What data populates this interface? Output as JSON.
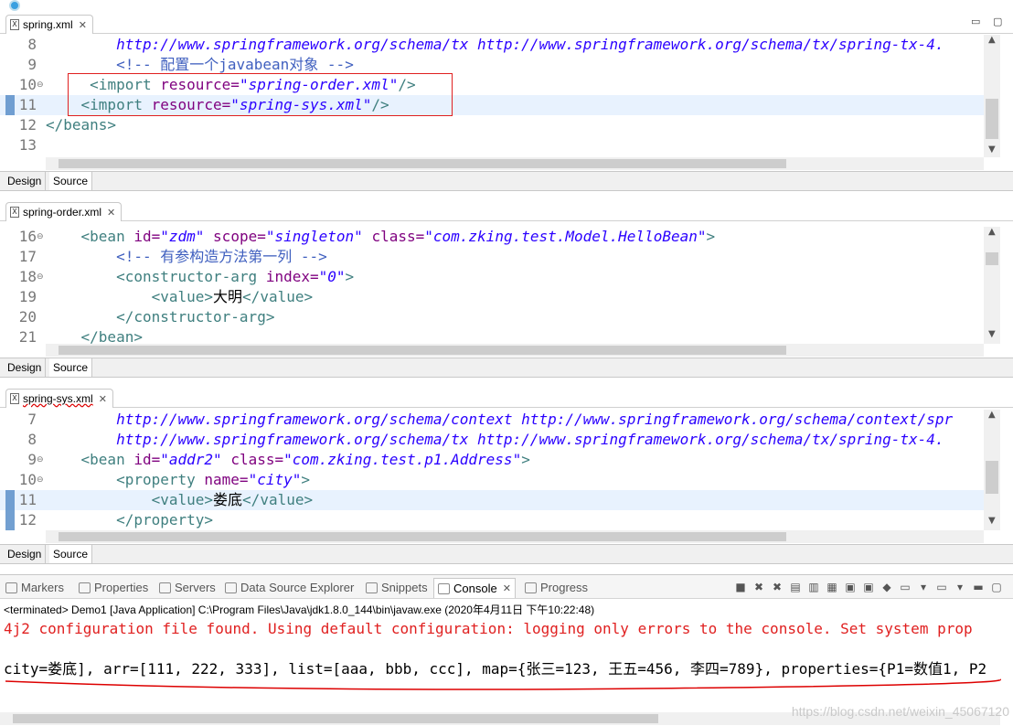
{
  "editors": [
    {
      "tab": "spring.xml",
      "lines": [
        {
          "num": "8",
          "code": [
            [
              "        ",
              "tx"
            ],
            [
              "http://www.springframework.org/schema/tx http://www.springframework.org/schema/tx/spring-tx-4.",
              "va"
            ]
          ]
        },
        {
          "num": "9",
          "code": [
            [
              "        ",
              "tx"
            ],
            [
              "<!-- 配置一个javabean对象 -->",
              "cm"
            ]
          ]
        },
        {
          "num": "10",
          "code": [
            [
              "     ",
              "tx"
            ],
            [
              "<import ",
              "tg"
            ],
            [
              "resource=",
              "at"
            ],
            [
              "\"spring-order.xml\"",
              "va"
            ],
            [
              "/>",
              "tg"
            ]
          ]
        },
        {
          "num": "11",
          "code": [
            [
              "    ",
              "tx"
            ],
            [
              "<import ",
              "tg"
            ],
            [
              "resource=",
              "at"
            ],
            [
              "\"spring-sys.xml\"",
              "va"
            ],
            [
              "/>",
              "tg"
            ]
          ]
        },
        {
          "num": "12",
          "code": [
            [
              "</beans>",
              "tg"
            ]
          ]
        },
        {
          "num": "13",
          "code": [
            [
              "",
              "tx"
            ]
          ]
        }
      ],
      "modes": [
        "Design",
        "Source"
      ]
    },
    {
      "tab": "spring-order.xml",
      "lines": [
        {
          "num": "16",
          "code": [
            [
              "    ",
              "tx"
            ],
            [
              "<bean ",
              "tg"
            ],
            [
              "id=",
              "at"
            ],
            [
              "\"zdm\"",
              "va"
            ],
            [
              " ",
              "tx"
            ],
            [
              "scope=",
              "at"
            ],
            [
              "\"singleton\"",
              "va"
            ],
            [
              " ",
              "tx"
            ],
            [
              "class=",
              "at"
            ],
            [
              "\"com.zking.test.Model.HelloBean\"",
              "va"
            ],
            [
              ">",
              "tg"
            ]
          ]
        },
        {
          "num": "17",
          "code": [
            [
              "        ",
              "tx"
            ],
            [
              "<!-- 有参构造方法第一列 -->",
              "cm"
            ]
          ]
        },
        {
          "num": "18",
          "code": [
            [
              "        ",
              "tx"
            ],
            [
              "<constructor-arg ",
              "tg"
            ],
            [
              "index=",
              "at"
            ],
            [
              "\"0\"",
              "va"
            ],
            [
              ">",
              "tg"
            ]
          ]
        },
        {
          "num": "19",
          "code": [
            [
              "            ",
              "tx"
            ],
            [
              "<value>",
              "tg"
            ],
            [
              "大明",
              "tx"
            ],
            [
              "</value>",
              "tg"
            ]
          ]
        },
        {
          "num": "20",
          "code": [
            [
              "        ",
              "tx"
            ],
            [
              "</constructor-arg>",
              "tg"
            ]
          ]
        },
        {
          "num": "21",
          "code": [
            [
              "    ",
              "tx"
            ],
            [
              "</bean>",
              "tg"
            ]
          ]
        }
      ],
      "modes": [
        "Design",
        "Source"
      ]
    },
    {
      "tab": "spring-sys.xml",
      "lines": [
        {
          "num": "7",
          "code": [
            [
              "        ",
              "tx"
            ],
            [
              "http://www.springframework.org/schema/context http://www.springframework.org/schema/context/spr",
              "va"
            ]
          ]
        },
        {
          "num": "8",
          "code": [
            [
              "        ",
              "tx"
            ],
            [
              "http://www.springframework.org/schema/tx http://www.springframework.org/schema/tx/spring-tx-4.",
              "va"
            ]
          ]
        },
        {
          "num": "9",
          "code": [
            [
              "    ",
              "tx"
            ],
            [
              "<bean ",
              "tg"
            ],
            [
              "id=",
              "at"
            ],
            [
              "\"addr2\"",
              "va"
            ],
            [
              " ",
              "tx"
            ],
            [
              "class=",
              "at"
            ],
            [
              "\"com.zking.test.p1.Address\"",
              "va"
            ],
            [
              ">",
              "tg"
            ]
          ]
        },
        {
          "num": "10",
          "code": [
            [
              "        ",
              "tx"
            ],
            [
              "<property ",
              "tg"
            ],
            [
              "name=",
              "at"
            ],
            [
              "\"city\"",
              "va"
            ],
            [
              ">",
              "tg"
            ]
          ]
        },
        {
          "num": "11",
          "code": [
            [
              "            ",
              "tx"
            ],
            [
              "<value>",
              "tg"
            ],
            [
              "娄底",
              "tx"
            ],
            [
              "</value>",
              "tg"
            ]
          ]
        },
        {
          "num": "12",
          "code": [
            [
              "        ",
              "tx"
            ],
            [
              "</property>",
              "tg"
            ]
          ]
        }
      ],
      "modes": [
        "Design",
        "Source"
      ]
    }
  ],
  "console": {
    "tabs": [
      "Markers",
      "Properties",
      "Servers",
      "Data Source Explorer",
      "Snippets",
      "Console",
      "Progress"
    ],
    "status": "<terminated> Demo1 [Java Application] C:\\Program Files\\Java\\jdk1.8.0_144\\bin\\javaw.exe (2020年4月11日 下午10:22:48)",
    "line1": "4j2 configuration file found. Using default configuration: logging only errors to the console. Set system prop",
    "line2": "city=娄底], arr=[111, 222, 333], list=[aaa, bbb, ccc], map={张三=123, 王五=456, 李四=789}, properties={P1=数值1, P2"
  },
  "watermark": "https://blog.csdn.net/weixin_45067120"
}
